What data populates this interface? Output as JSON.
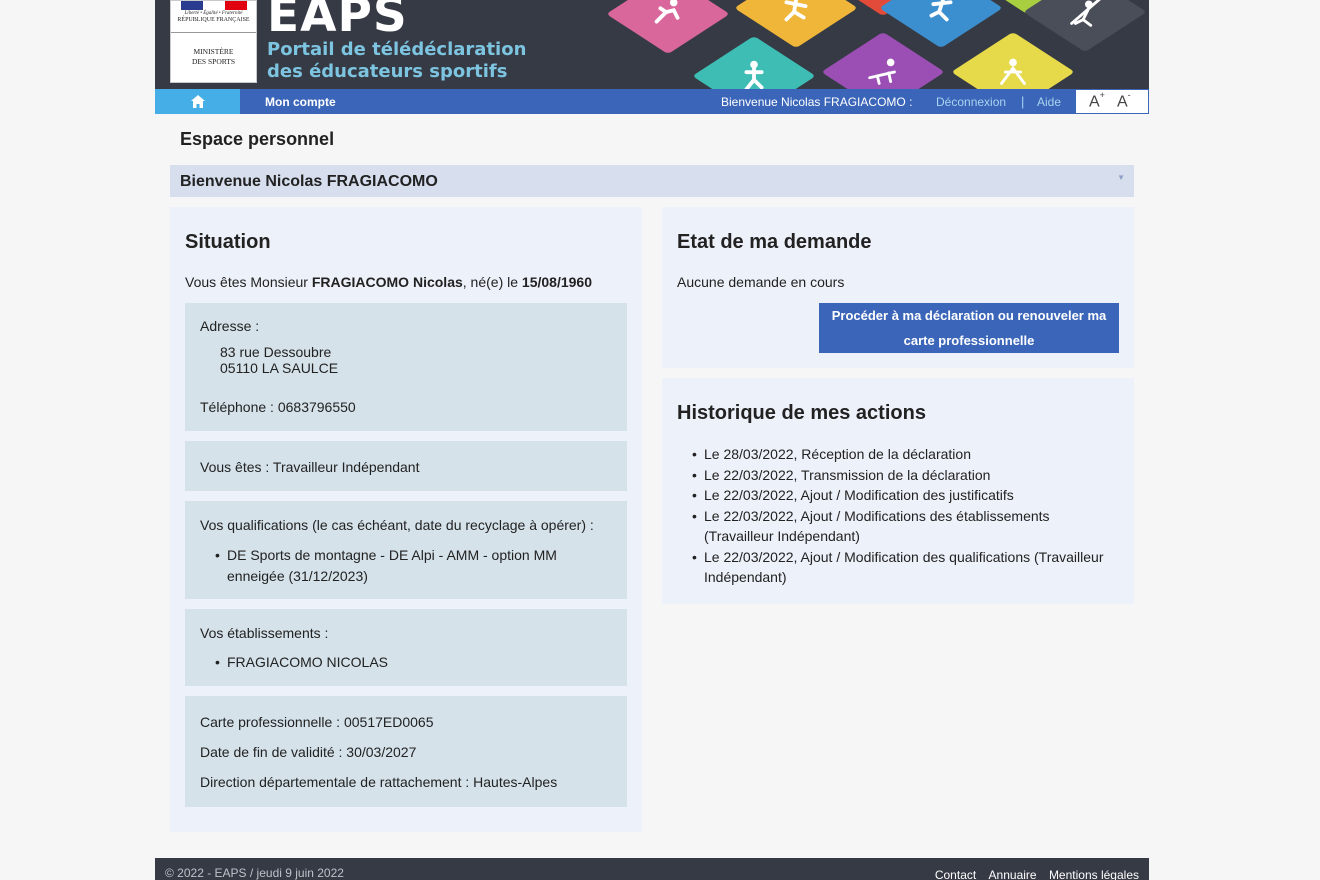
{
  "header": {
    "logo": {
      "motto": "Liberté • Égalité • Fraternité",
      "republic": "RÉPUBLIQUE FRANÇAISE",
      "ministry_line1": "MINISTÈRE",
      "ministry_line2": "DES SPORTS"
    },
    "brand": "EAPS",
    "tagline_line1": "Portail de télédéclaration",
    "tagline_line2": "des éducateurs sportifs",
    "colors": {
      "banner_bg": "#363a44",
      "tagline": "#7cc4e0",
      "tiles": [
        "#d9679b",
        "#3dbdb4",
        "#f0b63a",
        "#e24b3a",
        "#9b4fb4",
        "#3c8fcf",
        "#e6d94a",
        "#a8cf3f",
        "#4a4e58"
      ]
    }
  },
  "nav": {
    "home_icon": "home-icon",
    "account": "Mon compte",
    "welcome": "Bienvenue Nicolas FRAGIACOMO :",
    "logout": "Déconnexion",
    "separator": "|",
    "help": "Aide",
    "font_increase": "A",
    "font_decrease": "A",
    "font_increase_sup": "+",
    "font_decrease_sup": "-",
    "colors": {
      "bar": "#3b65b8",
      "home": "#46aee6",
      "links": "#a9d3ef"
    }
  },
  "page": {
    "title": "Espace personnel",
    "welcome": "Bienvenue Nicolas FRAGIACOMO",
    "toggle_icon": "chevron-down-icon"
  },
  "situation": {
    "title": "Situation",
    "intro_prefix": "Vous êtes Monsieur ",
    "name": "FRAGIACOMO Nicolas",
    "intro_mid": ", né(e) le ",
    "birth_date": "15/08/1960",
    "address_label": "Adresse :",
    "address_line1": "83 rue Dessoubre",
    "address_line2": "05110 LA SAULCE",
    "phone": "Téléphone : 0683796550",
    "status": "Vous êtes : Travailleur Indépendant",
    "qualifications_label": "Vos qualifications (le cas échéant, date du recyclage à opérer) :",
    "qualifications": [
      "DE Sports de montagne - DE Alpi - AMM - option MM enneigée (31/12/2023)"
    ],
    "establishments_label": "Vos établissements :",
    "establishments": [
      "FRAGIACOMO NICOLAS"
    ],
    "card": "Carte professionnelle : 00517ED0065",
    "validity": "Date de fin de validité : 30/03/2027",
    "direction": "Direction départementale de rattachement : Hautes-Alpes"
  },
  "request": {
    "title": "Etat de ma demande",
    "status": "Aucune demande en cours",
    "button_line1": "Procéder à ma déclaration ou renouveler ma",
    "button_line2": "carte professionnelle"
  },
  "history": {
    "title": "Historique de mes actions",
    "items": [
      "Le 28/03/2022, Réception de la déclaration",
      "Le 22/03/2022, Transmission de la déclaration",
      "Le 22/03/2022, Ajout / Modification des justificatifs",
      "Le 22/03/2022, Ajout / Modifications des établissements (Travailleur Indépendant)",
      "Le 22/03/2022, Ajout / Modification des qualifications (Travailleur Indépendant)"
    ]
  },
  "footer": {
    "copyright": "© 2022 - EAPS / jeudi 9 juin 2022",
    "links": [
      "Contact",
      "Annuaire",
      "Mentions légales"
    ]
  }
}
